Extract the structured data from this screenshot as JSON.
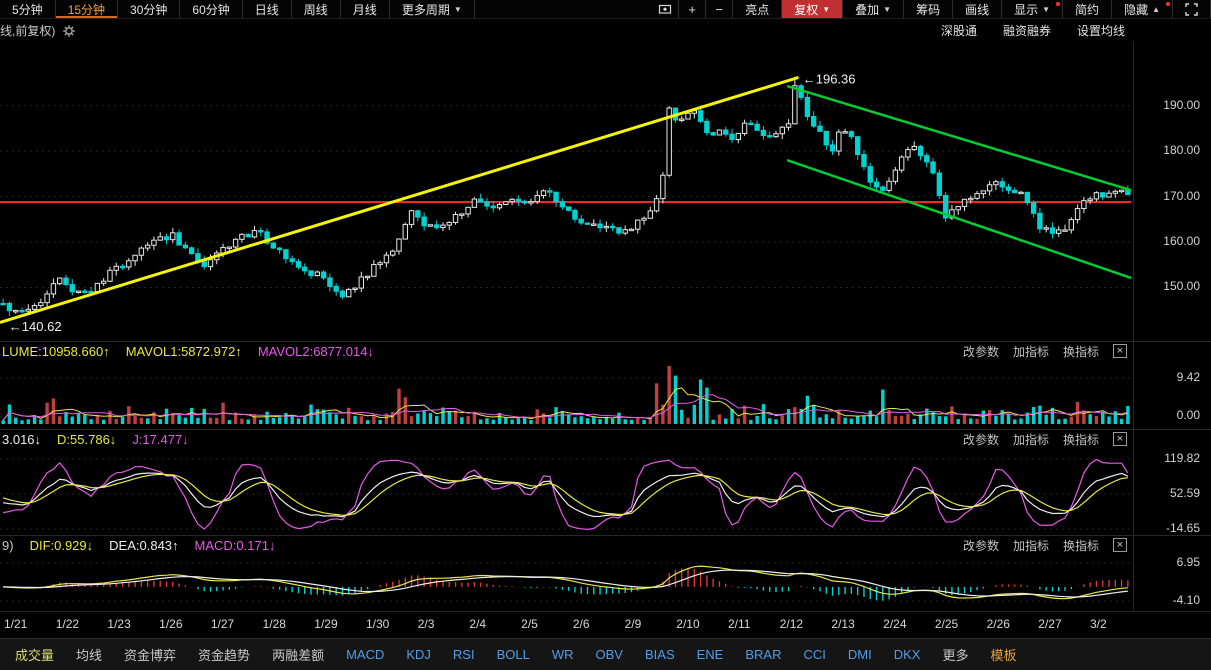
{
  "colors": {
    "up": "#e8e8e8",
    "down": "#00d2d2",
    "accent_orange": "#f0a030",
    "red_button": "#c03030",
    "line_yellow": "#e8e840",
    "line_magenta": "#e858e8",
    "line_white": "#ededed",
    "tab_blue": "#4f9eea",
    "hline_red": "#ff2222",
    "trend_yellow": "#f5f500",
    "trend_green": "#00cc33"
  },
  "toolbar": {
    "periods": [
      {
        "id": "5min",
        "label": "5分钟"
      },
      {
        "id": "15min",
        "label": "15分钟",
        "active": true
      },
      {
        "id": "30min",
        "label": "30分钟"
      },
      {
        "id": "60min",
        "label": "60分钟"
      },
      {
        "id": "day",
        "label": "日线"
      },
      {
        "id": "week",
        "label": "周线"
      },
      {
        "id": "month",
        "label": "月线"
      },
      {
        "id": "more-periods",
        "label": "更多周期",
        "arrow": "▼"
      }
    ],
    "icon_cells": [
      {
        "id": "screenshot"
      },
      {
        "id": "zoom-in",
        "glyph": "+"
      },
      {
        "id": "zoom-out",
        "glyph": "−"
      }
    ],
    "tools": [
      {
        "id": "highlights",
        "label": "亮点"
      },
      {
        "id": "adjust-price",
        "label": "复权",
        "arrow": "▼",
        "highlight": true
      },
      {
        "id": "overlay",
        "label": "叠加",
        "arrow": "▼"
      },
      {
        "id": "chips",
        "label": "筹码"
      },
      {
        "id": "draw-line",
        "label": "画线"
      },
      {
        "id": "display",
        "label": "显示",
        "arrow": "▼",
        "dot": true
      },
      {
        "id": "simple",
        "label": "简约"
      },
      {
        "id": "hide",
        "label": "隐藏",
        "arrow": "▲",
        "dot": true
      }
    ]
  },
  "subheader": {
    "left": "线,前复权)",
    "links": [
      {
        "id": "sz-connect",
        "label": "深股通"
      },
      {
        "id": "margin-trading",
        "label": "融资融券"
      },
      {
        "id": "ma-settings",
        "label": "设置均线"
      }
    ]
  },
  "panel_links": {
    "edit": "改参数",
    "add": "加指标",
    "switch": "换指标",
    "close": "×"
  },
  "volume_header": {
    "vol": "LUME:10958.660↑",
    "ma1": "MAVOL1:5872.972↑",
    "ma2": "MAVOL2:6877.014↓"
  },
  "kdj_header": {
    "k": "3.016↓",
    "d": "D:55.786↓",
    "j": "J:17.477↓"
  },
  "macd_header": {
    "prefix": "9)",
    "dif": "DIF:0.929↓",
    "dea": "DEA:0.843↑",
    "macd": "MACD:0.171↓"
  },
  "axis": {
    "main": [
      "190.00",
      "180.00",
      "170.00",
      "160.00",
      "150.00"
    ],
    "volume": [
      "9.42",
      "0.00"
    ],
    "kdj": [
      "119.82",
      "52.59",
      "-14.65"
    ],
    "macd": [
      "6.95",
      "-4.10"
    ]
  },
  "dates": [
    "1/21",
    "1/22",
    "1/23",
    "1/26",
    "1/27",
    "1/28",
    "1/29",
    "1/30",
    "2/3",
    "2/4",
    "2/5",
    "2/6",
    "2/9",
    "2/10",
    "2/11",
    "2/12",
    "2/13",
    "2/24",
    "2/25",
    "2/26",
    "2/27",
    "3/2"
  ],
  "bottom_tabs": [
    {
      "id": "volume",
      "label": "成交量",
      "color": "#d8d870"
    },
    {
      "id": "ma",
      "label": "均线",
      "color": "#c8c8c8"
    },
    {
      "id": "capital-game",
      "label": "资金博弈",
      "color": "#c8c8c8"
    },
    {
      "id": "capital-trend",
      "label": "资金趋势",
      "color": "#c8c8c8"
    },
    {
      "id": "margin-diff",
      "label": "两融差额",
      "color": "#c8c8c8"
    },
    {
      "id": "macd",
      "label": "MACD",
      "color": "#4f9eea"
    },
    {
      "id": "kdj",
      "label": "KDJ",
      "color": "#4f9eea"
    },
    {
      "id": "rsi",
      "label": "RSI",
      "color": "#4f9eea"
    },
    {
      "id": "boll",
      "label": "BOLL",
      "color": "#4f9eea"
    },
    {
      "id": "wr",
      "label": "WR",
      "color": "#4f9eea"
    },
    {
      "id": "obv",
      "label": "OBV",
      "color": "#4f9eea"
    },
    {
      "id": "bias",
      "label": "BIAS",
      "color": "#4f9eea"
    },
    {
      "id": "ene",
      "label": "ENE",
      "color": "#4f9eea"
    },
    {
      "id": "brar",
      "label": "BRAR",
      "color": "#4f9eea"
    },
    {
      "id": "cci",
      "label": "CCI",
      "color": "#4f9eea"
    },
    {
      "id": "dmi",
      "label": "DMI",
      "color": "#4f9eea"
    },
    {
      "id": "dkx",
      "label": "DKX",
      "color": "#4f9eea"
    },
    {
      "id": "more",
      "label": "更多",
      "color": "#c8c8c8"
    },
    {
      "id": "template",
      "label": "模板",
      "color": "#e6a23c"
    }
  ],
  "chart_data": {
    "type": "candlestick",
    "n_candles": 180,
    "ylim": [
      138,
      204
    ],
    "price_keypoints": [
      [
        0,
        146.5
      ],
      [
        0.015,
        143.8
      ],
      [
        0.03,
        146.0
      ],
      [
        0.05,
        151.5
      ],
      [
        0.065,
        149.0
      ],
      [
        0.08,
        150.0
      ],
      [
        0.1,
        154.0
      ],
      [
        0.13,
        159.5
      ],
      [
        0.15,
        161.5
      ],
      [
        0.165,
        158.0
      ],
      [
        0.18,
        155.0
      ],
      [
        0.2,
        159.5
      ],
      [
        0.225,
        162.5
      ],
      [
        0.245,
        158.0
      ],
      [
        0.26,
        155.0
      ],
      [
        0.285,
        152.0
      ],
      [
        0.302,
        147.8
      ],
      [
        0.315,
        151.0
      ],
      [
        0.33,
        154.5
      ],
      [
        0.35,
        159.5
      ],
      [
        0.362,
        166.5
      ],
      [
        0.378,
        163.0
      ],
      [
        0.4,
        165.0
      ],
      [
        0.418,
        169.0
      ],
      [
        0.435,
        167.5
      ],
      [
        0.45,
        169.5
      ],
      [
        0.468,
        168.5
      ],
      [
        0.482,
        171.5
      ],
      [
        0.5,
        167.0
      ],
      [
        0.515,
        164.0
      ],
      [
        0.53,
        163.2
      ],
      [
        0.55,
        161.8
      ],
      [
        0.565,
        164.5
      ],
      [
        0.578,
        168.0
      ],
      [
        0.585,
        170.0
      ],
      [
        0.592,
        189.5
      ],
      [
        0.6,
        186.0
      ],
      [
        0.613,
        189.0
      ],
      [
        0.625,
        183.5
      ],
      [
        0.637,
        185.0
      ],
      [
        0.648,
        182.0
      ],
      [
        0.66,
        186.5
      ],
      [
        0.672,
        184.0
      ],
      [
        0.685,
        182.5
      ],
      [
        0.698,
        186.0
      ],
      [
        0.703,
        195.5
      ],
      [
        0.71,
        192.0
      ],
      [
        0.718,
        186.0
      ],
      [
        0.727,
        184.0
      ],
      [
        0.737,
        180.0
      ],
      [
        0.745,
        184.5
      ],
      [
        0.753,
        183.0
      ],
      [
        0.762,
        178.5
      ],
      [
        0.772,
        172.5
      ],
      [
        0.78,
        170.5
      ],
      [
        0.79,
        174.0
      ],
      [
        0.8,
        180.0
      ],
      [
        0.808,
        181.0
      ],
      [
        0.817,
        179.0
      ],
      [
        0.825,
        177.5
      ],
      [
        0.833,
        170.0
      ],
      [
        0.838,
        164.5
      ],
      [
        0.847,
        168.0
      ],
      [
        0.858,
        170.0
      ],
      [
        0.872,
        171.8
      ],
      [
        0.885,
        172.8
      ],
      [
        0.895,
        171.8
      ],
      [
        0.903,
        170.8
      ],
      [
        0.913,
        168.0
      ],
      [
        0.922,
        163.5
      ],
      [
        0.935,
        161.0
      ],
      [
        0.947,
        164.0
      ],
      [
        0.957,
        168.0
      ],
      [
        0.966,
        170.0
      ],
      [
        0.975,
        171.0
      ],
      [
        0.983,
        170.0
      ],
      [
        0.992,
        172.0
      ],
      [
        1,
        171.0
      ]
    ],
    "peak": {
      "t": 0.703,
      "high": 196.36
    },
    "hline": {
      "price": 168.8,
      "color": "#ff2222"
    },
    "trend_lines": [
      {
        "name": "yellow-uptrend",
        "color": "#f5f500",
        "width": 3,
        "points_tp": [
          [
            0,
            142.3
          ],
          [
            0.706,
            196.2
          ]
        ]
      },
      {
        "name": "green-channel-upper",
        "color": "#00cc33",
        "width": 2.5,
        "points_tp": [
          [
            0.696,
            194.3
          ],
          [
            1,
            171.4
          ]
        ]
      },
      {
        "name": "green-channel-lower",
        "color": "#00cc33",
        "width": 2.5,
        "points_tp": [
          [
            0.696,
            178.0
          ],
          [
            1,
            152.1
          ]
        ]
      }
    ],
    "annotations": [
      {
        "text": "←140.62",
        "t": 0.006,
        "price": 141.3
      },
      {
        "text": "←196.36",
        "t": 0.708,
        "price": 195.8
      }
    ],
    "volume_spikes": [
      {
        "t": 0.35,
        "m": 2.2
      },
      {
        "t": 0.398,
        "m": 4.5
      },
      {
        "t": 0.482,
        "m": 2.6
      },
      {
        "t": 0.52,
        "m": 2.0
      },
      {
        "t": 0.585,
        "m": 2.8
      },
      {
        "t": 0.6,
        "m": 2.4
      },
      {
        "t": 0.62,
        "m": 2.2
      },
      {
        "t": 0.703,
        "m": 2.6
      },
      {
        "t": 0.78,
        "m": 2.6
      },
      {
        "t": 0.822,
        "m": 2.4
      },
      {
        "t": 0.915,
        "m": 2.0
      }
    ],
    "indicators": {
      "volume": {
        "VOLUME": 10958.66,
        "MAVOL1": 5872.972,
        "MAVOL2": 6877.014
      },
      "kdj": {
        "K_visible": "3.016",
        "D": 55.786,
        "J": 17.477
      },
      "macd": {
        "DIF": 0.929,
        "DEA": 0.843,
        "MACD": 0.171
      }
    },
    "y_axis_main": [
      190,
      180,
      170,
      160,
      150
    ]
  }
}
